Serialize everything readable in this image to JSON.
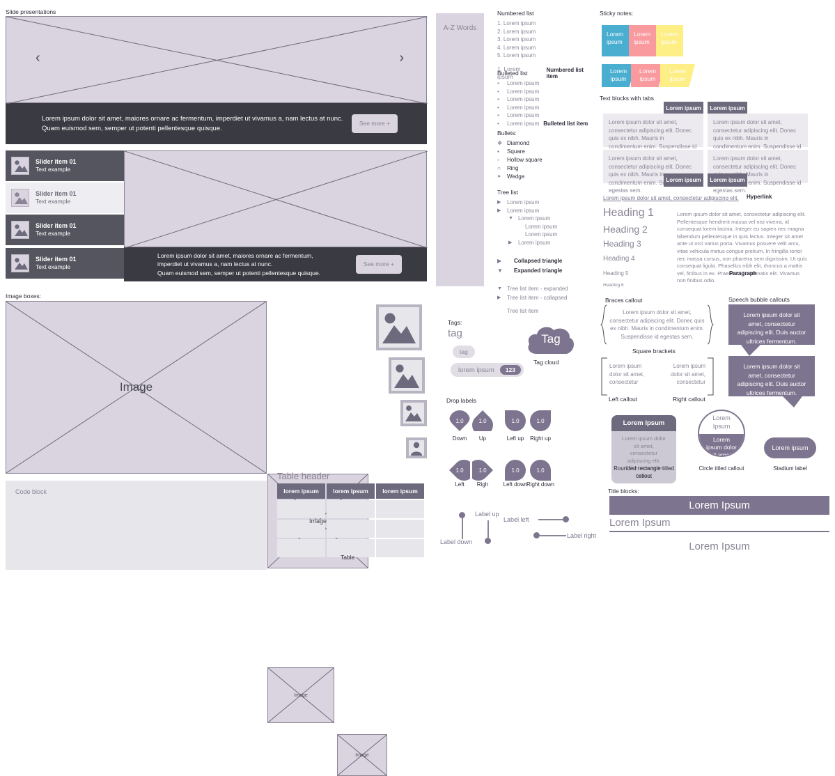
{
  "sections": {
    "slide_presentations": "Slide presentations",
    "image_boxes": "Image boxes:",
    "sticky_notes": "Sticky notes:",
    "text_blocks_tabs": "Text blocks with tabs",
    "numbered_list": "Numbered list",
    "bulleted_list": "Bulleted list",
    "bullets": "Bullets:",
    "tree_list": "Tree list",
    "tags": "Tags:",
    "drop_labels": "Drop labels",
    "braces_callout": "Braces callout",
    "square_brackets": "Square brackets",
    "speech_bubble_callouts": "Speech bubble callouts",
    "title_blocks": "Title blocks:"
  },
  "slide": {
    "caption_line1": "Lorem ipsum dolor sit amet, maiores ornare ac fermentum, imperdiet ut vivamus a, nam lectus at nunc.",
    "caption_line2": "Quam euismod sem, semper ut potenti pellentesque quisque.",
    "caption2_line1": "Lorem ipsum dolor sit amet, maiores ornare ac fermentum,",
    "caption2_line2": "imperdiet ut vivamus a, nam lectus at nunc.",
    "caption2_line3": "Quam euismod sem, semper ut potenti pellentesque quisque.",
    "see_more": "See more +",
    "prev_icon": "‹",
    "next_icon": "›"
  },
  "slider_items": [
    {
      "title": "Slider item 01",
      "text": "Text example",
      "state": "dark"
    },
    {
      "title": "Slider item 01",
      "text": "Text example",
      "state": "light"
    },
    {
      "title": "Slider item 01",
      "text": "Text example",
      "state": "dark"
    },
    {
      "title": "Slider item 01",
      "text": "Text example",
      "state": "dark"
    }
  ],
  "image_box_labels": {
    "big": "Image",
    "medium": "Image",
    "small": "Image",
    "wide": "Image",
    "code_block": "Code block"
  },
  "table": {
    "header": "Table header",
    "columns": [
      "lorem ipsum",
      "lorem ipsum",
      "lorem ipsum"
    ],
    "rows": [
      [
        "",
        "",
        ""
      ],
      [
        "",
        "",
        ""
      ],
      [
        "",
        "",
        ""
      ]
    ],
    "caption": "Table"
  },
  "az_words": "A-Z Words",
  "numbered_list": {
    "items": [
      "1.   Lorem ipsum",
      "2.   Lorem ipsum",
      "3.   Lorem ipsum",
      "4.   Lorem ipsum",
      "5.   Lorem ipsum"
    ],
    "sample": "1.   Lorem ipsum",
    "annotation": "Numbered list item"
  },
  "bulleted_list": {
    "items": [
      "Lorem ipsum",
      "Lorem ipsum",
      "Lorem ipsum",
      "Lorem ipsum",
      "Lorem ipsum"
    ],
    "sample": "Lorem ipsum",
    "annotation": "Bulleted list item"
  },
  "bullets": [
    {
      "glyph": "❖",
      "label": "Diamond"
    },
    {
      "glyph": "▪",
      "label": "Square"
    },
    {
      "glyph": "▫",
      "label": "Hollow square"
    },
    {
      "glyph": "○",
      "label": "Ring"
    },
    {
      "glyph": "➤",
      "label": "Wedge"
    }
  ],
  "tree_list": {
    "rows": [
      {
        "indent": 0,
        "marker": "collapsed",
        "text": "Lorem ipsum"
      },
      {
        "indent": 0,
        "marker": "collapsed",
        "text": "Lorem ipsum"
      },
      {
        "indent": 1,
        "marker": "expanded",
        "text": "Lorem ipsum"
      },
      {
        "indent": 3,
        "marker": "none",
        "text": "Lorem ipsum"
      },
      {
        "indent": 3,
        "marker": "none",
        "text": "Lorem ipsum"
      },
      {
        "indent": 1,
        "marker": "collapsed",
        "text": "Lorem ipsum"
      }
    ],
    "legend": [
      {
        "marker": "collapsed",
        "label": "Collapsed triangle"
      },
      {
        "marker": "expanded",
        "label": "Expanded triangle"
      }
    ],
    "annotations": [
      {
        "marker": "expanded",
        "label": "Tree list item - expanded"
      },
      {
        "marker": "collapsed",
        "label": "Tree list item - collapsed"
      },
      {
        "marker": "none",
        "label": "Tree list item"
      }
    ]
  },
  "sticky_notes": {
    "row1": [
      {
        "text1": "Lorem",
        "text2": "ipsum",
        "color": "#4aaed0"
      },
      {
        "text1": "Lorem",
        "text2": "ipsum",
        "color": "#f99a9f"
      },
      {
        "text1": "Lorem",
        "text2": "ipsum",
        "color": "#fdee86"
      }
    ],
    "row2": [
      {
        "text1": "Lorem",
        "text2": "ipsum",
        "color": "#4aaed0"
      },
      {
        "text1": "Lorem",
        "text2": "ipsum",
        "color": "#f99a9f"
      },
      {
        "text1": "Lorem",
        "text2": "ipsum",
        "color": "#fdee86"
      }
    ]
  },
  "text_blocks": {
    "tab_label": "Lorem ipsum",
    "body": "Lorem ipsum dolor sit amet, consectetur adipiscing elit. Donec quis ex nibh. Mauris in condimentum enim. Suspendisse id egestas sem."
  },
  "hyperlink": {
    "text": "Lorem ipsum dolor sit amet, consectetur adipiscing elit.",
    "annotation": "Hyperlink"
  },
  "headings": [
    "Heading 1",
    "Heading 2",
    "Heading 3",
    "Heading 4",
    "Heading 5",
    "Heading 6"
  ],
  "paragraph": {
    "text": "Lorem ipsum dolor sit amet, consectetur adipiscing elit. Pellentesque hendrerit massa vel nisi viverra, id consequat lorem lacinia. Integer eu sapien nec magna bibendum pellentesque in quis lectus. Integer sit amet ante ut orci varius porta. Vivamus posuere velit arcu, vitae vehicula metus congue pretium. In fringilla tortor nec massa cursus, non pharetra sem dignissim. Ut quis consequat ligula. Phasellus nibh elit, rhoncus a mattis vel, finibus in ex. Praesent id venenatis elit. Vivamus non finibus odio.",
    "annotation": "Paragraph"
  },
  "braces_callout": {
    "text": "Lorem ipsum dolor sit amet, consectetur adipiscing elit. Donec quis ex nibh. Mauris in condimentum enim. Suspendisse id egestas sem."
  },
  "square_brackets": {
    "left_text": "Lorem ipsum dolor sit amet, consectetur",
    "right_text": "Lorem ipsum dolor sit amet, consectetur",
    "left_caption": "Left callout",
    "right_caption": "Right callout"
  },
  "speech_bubbles": {
    "text": "Lorem ipsum dolor sit amet, consectetur adipiscing elit. Duis auctor ultrices fermentum."
  },
  "tags": {
    "plain": "tag",
    "pill": "tag",
    "pill_label": "lorem ipsum",
    "pill_count": "123",
    "cloud_text": "Tag",
    "cloud_caption": "Tag cloud"
  },
  "drop_labels": {
    "value": "1.0",
    "row1": [
      "Down",
      "Up",
      "Left up",
      "Right up"
    ],
    "row2": [
      "Left",
      "Righ",
      "Left down",
      "Right down"
    ]
  },
  "label_lines": [
    {
      "text": "Label down",
      "dir": "down"
    },
    {
      "text": "Label up",
      "dir": "up"
    },
    {
      "text": "Label left",
      "dir": "left"
    },
    {
      "text": "Label right",
      "dir": "right"
    }
  ],
  "shapes": {
    "rounded_title": "Lorem Ipsum",
    "rounded_body": "Lorem ipsum dolor sit amet, consectetur adipiscing elit. Etiam non enim neque.",
    "rounded_caption": "Rounded rectangle titled callout",
    "circle_title1": "Lorem",
    "circle_title2": "Ipsum",
    "circle_body": "Lorem ipsum dolor sit amet.",
    "circle_caption": "Circle titled callout",
    "stadium_label": "Lorem ipsum",
    "stadium_caption": "Stadium label"
  },
  "title_blocks": {
    "block1": "Lorem Ipsum",
    "block2": "Lorem Ipsum",
    "block3": "Lorem Ipsum"
  },
  "colors": {
    "purple": "#7d758f",
    "lavender": "#d9d4df",
    "dark": "#3a3a42",
    "grey": "#e7e6eb",
    "sticky_blue": "#4aaed0",
    "sticky_pink": "#f99a9f",
    "sticky_yellow": "#fdee86"
  }
}
